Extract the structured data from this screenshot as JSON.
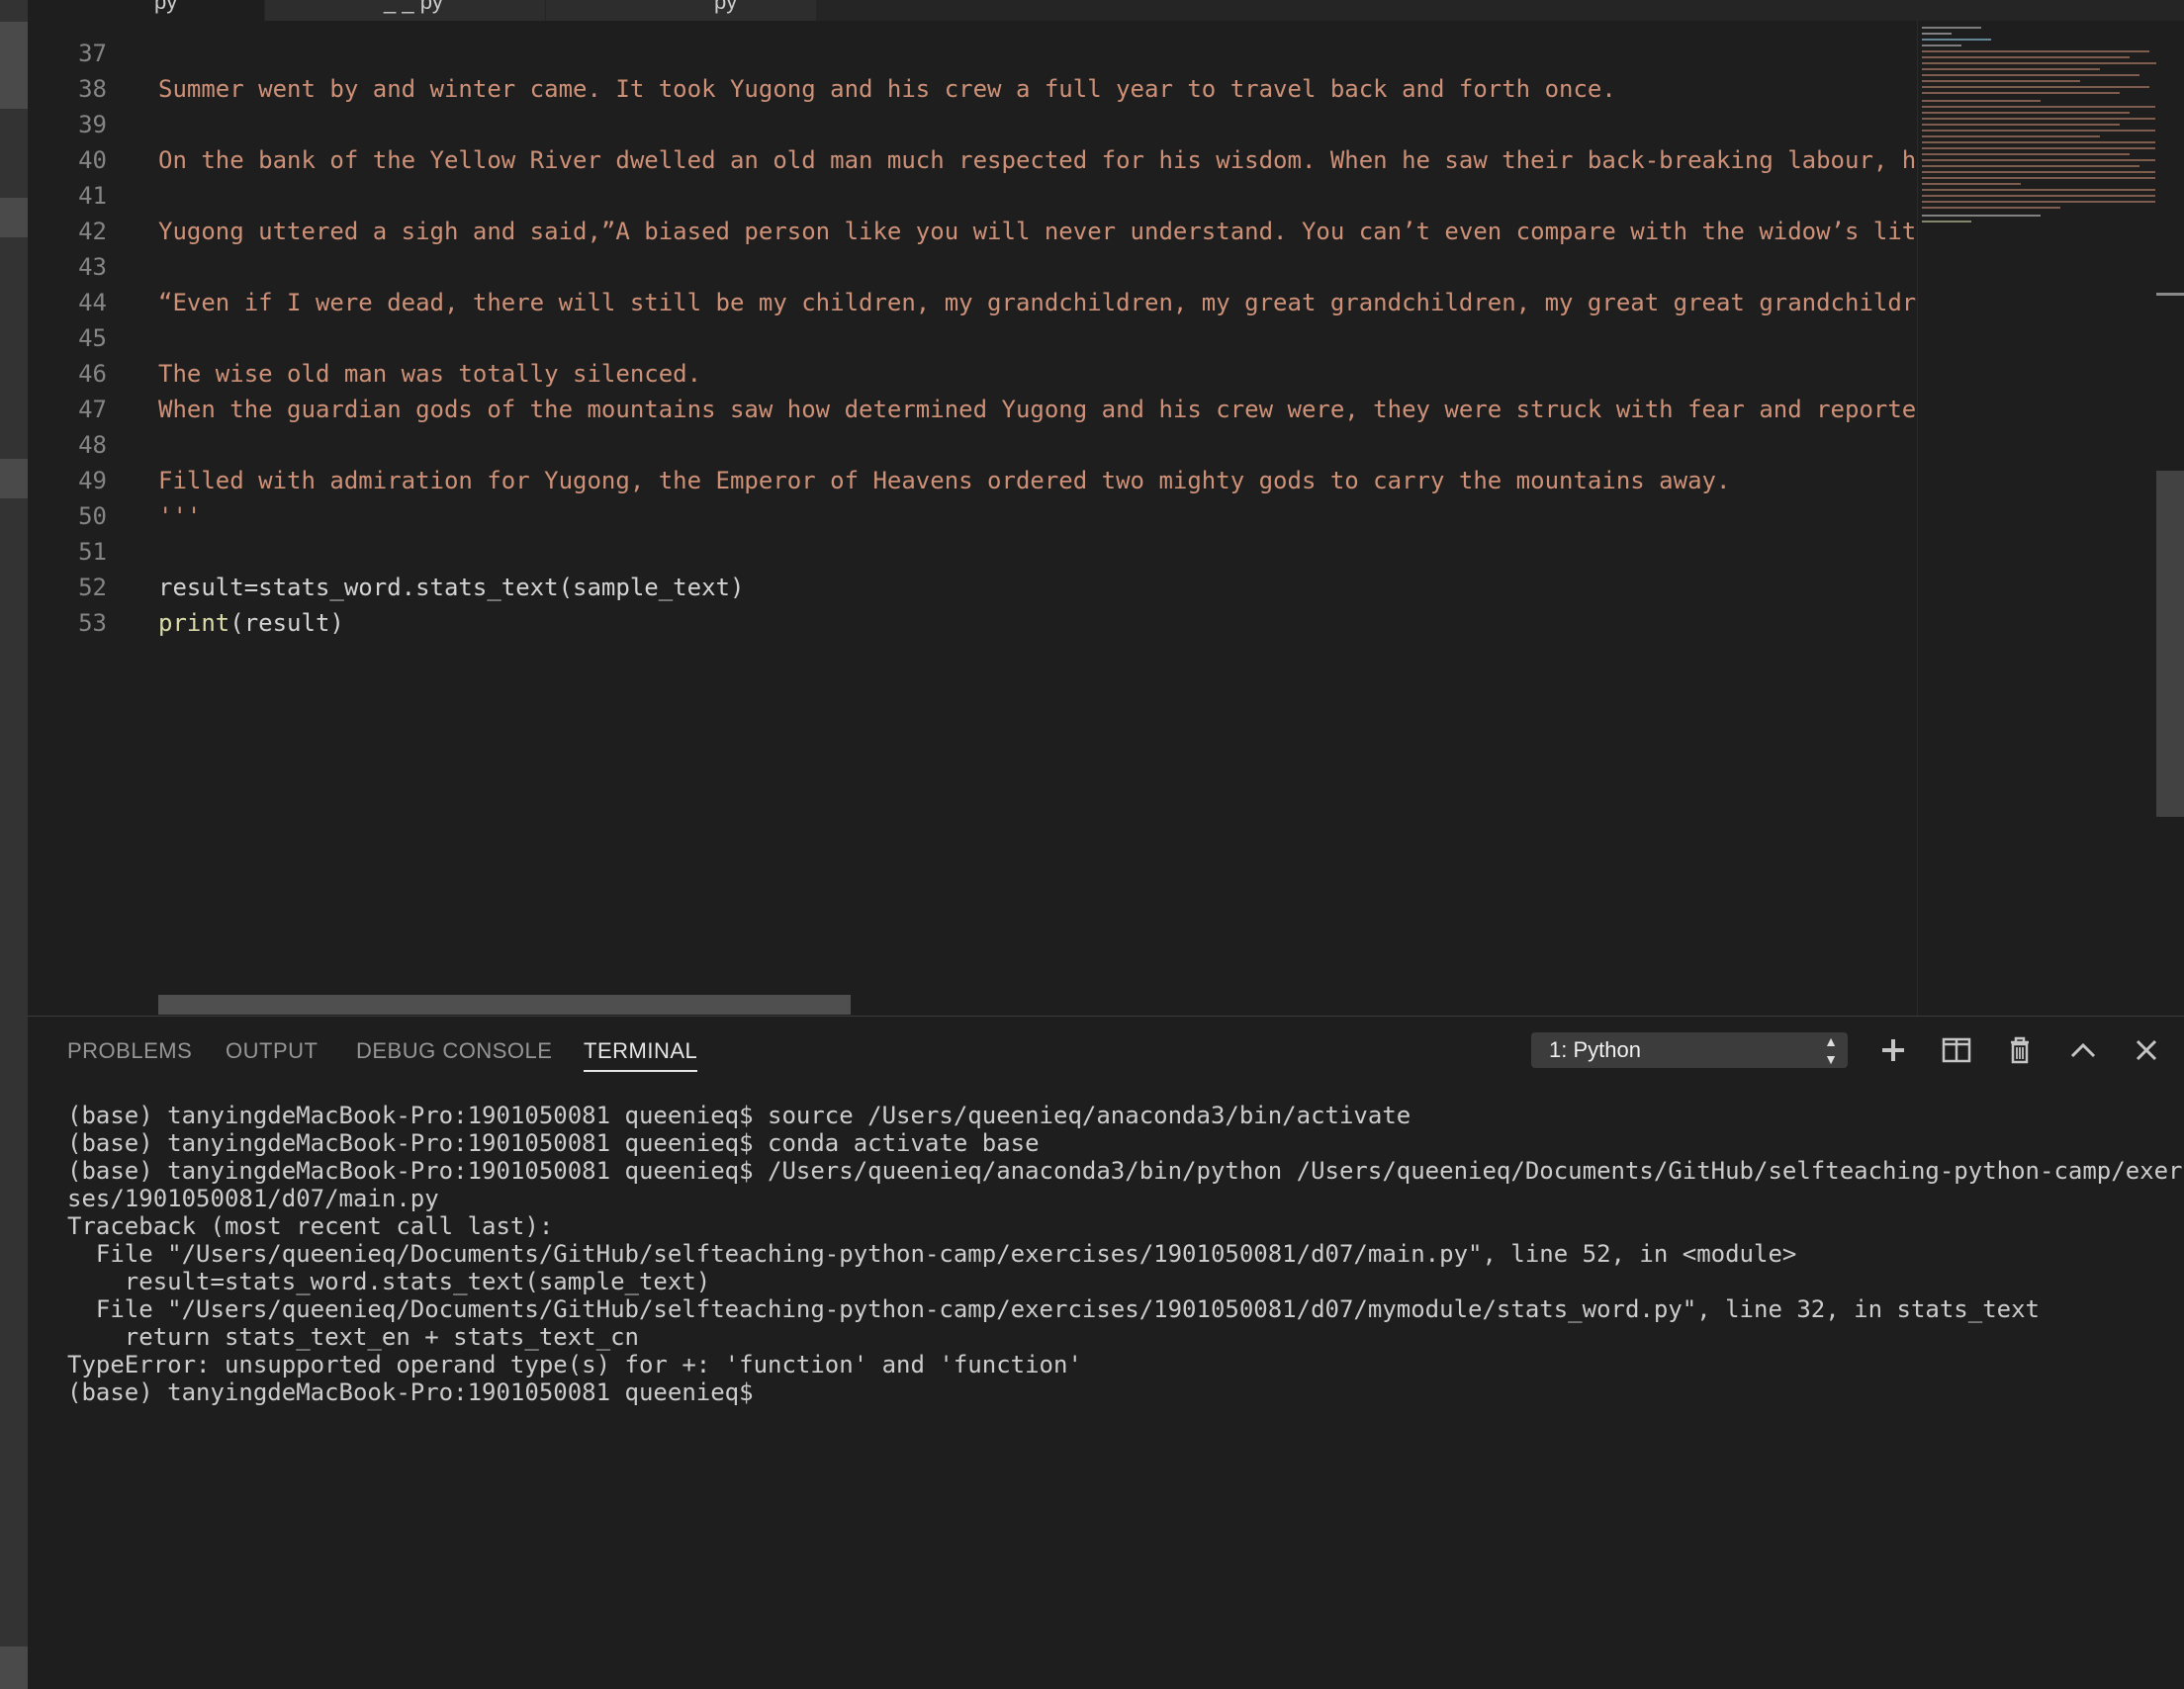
{
  "tabs": [
    {
      "label": "py",
      "active": true
    },
    {
      "label": "_ _ py",
      "active": false
    },
    {
      "label": "py",
      "active": false
    }
  ],
  "editor": {
    "lines": [
      {
        "n": "37",
        "text": "",
        "kind": "plain"
      },
      {
        "n": "38",
        "text": "Summer went by and winter came. It took Yugong and his crew a full year to travel back and forth once.",
        "kind": "str"
      },
      {
        "n": "39",
        "text": "",
        "kind": "plain"
      },
      {
        "n": "40",
        "text": "On the bank of the Yellow River dwelled an old man much respected for his wisdom. When he saw their back-breaking labour, h",
        "kind": "str"
      },
      {
        "n": "41",
        "text": "",
        "kind": "plain"
      },
      {
        "n": "42",
        "text": "Yugong uttered a sigh and said,”A biased person like you will never understand. You can’t even compare with the widow’s lit",
        "kind": "str"
      },
      {
        "n": "43",
        "text": "",
        "kind": "plain"
      },
      {
        "n": "44",
        "text": "“Even if I were dead, there will still be my children, my grandchildren, my great grandchildren, my great great grandchildre",
        "kind": "str"
      },
      {
        "n": "45",
        "text": "",
        "kind": "plain"
      },
      {
        "n": "46",
        "text": "The wise old man was totally silenced.",
        "kind": "str"
      },
      {
        "n": "47",
        "text": "When the guardian gods of the mountains saw how determined Yugong and his crew were, they were struck with fear and reporte",
        "kind": "str"
      },
      {
        "n": "48",
        "text": "",
        "kind": "plain"
      },
      {
        "n": "49",
        "text": "Filled with admiration for Yugong, the Emperor of Heavens ordered two mighty gods to carry the mountains away.",
        "kind": "str"
      },
      {
        "n": "50",
        "text": "'''",
        "kind": "str"
      },
      {
        "n": "51",
        "text": "",
        "kind": "plain"
      },
      {
        "n": "52",
        "text": "result=stats_word.stats_text(sample_text)",
        "kind": "plain"
      },
      {
        "n": "53",
        "text": "",
        "kind": "call",
        "fn": "print",
        "rest": "(result)"
      }
    ]
  },
  "panel": {
    "tabs": [
      "PROBLEMS",
      "OUTPUT",
      "DEBUG CONSOLE",
      "TERMINAL"
    ],
    "active_tab": "TERMINAL",
    "terminal_select": "1: Python",
    "icons": [
      "plus-icon",
      "split-icon",
      "trash-icon",
      "chevron-up-icon",
      "close-icon"
    ],
    "terminal_lines": [
      "(base) tanyingdeMacBook-Pro:1901050081 queenieq$ source /Users/queenieq/anaconda3/bin/activate",
      "(base) tanyingdeMacBook-Pro:1901050081 queenieq$ conda activate base",
      "(base) tanyingdeMacBook-Pro:1901050081 queenieq$ /Users/queenieq/anaconda3/bin/python /Users/queenieq/Documents/GitHub/selfteaching-python-camp/exerci",
      "ses/1901050081/d07/main.py",
      "Traceback (most recent call last):",
      "  File \"/Users/queenieq/Documents/GitHub/selfteaching-python-camp/exercises/1901050081/d07/main.py\", line 52, in <module>",
      "    result=stats_word.stats_text(sample_text)",
      "  File \"/Users/queenieq/Documents/GitHub/selfteaching-python-camp/exercises/1901050081/d07/mymodule/stats_word.py\", line 32, in stats_text",
      "    return stats_text_en + stats_text_cn",
      "TypeError: unsupported operand type(s) for +: 'function' and 'function'",
      "(base) tanyingdeMacBook-Pro:1901050081 queenieq$"
    ]
  },
  "colors": {
    "string": "#ce9178",
    "function": "#dcdcaa",
    "line_number": "#858585",
    "background": "#1e1e1e"
  }
}
